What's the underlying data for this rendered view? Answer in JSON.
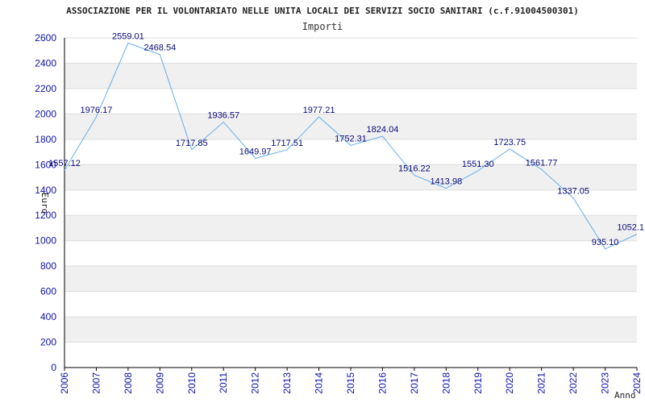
{
  "chart_data": {
    "type": "line",
    "title": "ASSOCIAZIONE PER IL VOLONTARIATO NELLE UNITA LOCALI DEI SERVIZI SOCIO SANITARI (c.f.91004500301)",
    "subtitle": "Importi",
    "xlabel": "Anno",
    "ylabel": "Euro",
    "ylim": [
      0,
      2600
    ],
    "yticks": [
      0,
      200,
      400,
      600,
      800,
      1000,
      1200,
      1400,
      1600,
      1800,
      2000,
      2200,
      2400,
      2600
    ],
    "x": [
      "2006",
      "2007",
      "2008",
      "2009",
      "2010",
      "2011",
      "2012",
      "2013",
      "2014",
      "2015",
      "2016",
      "2017",
      "2018",
      "2019",
      "2020",
      "2021",
      "2022",
      "2023",
      "2024"
    ],
    "values": [
      1557.12,
      1976.17,
      2559.01,
      2468.54,
      1717.85,
      1936.57,
      1649.97,
      1717.51,
      1977.21,
      1752.31,
      1824.04,
      1516.22,
      1413.98,
      1551.3,
      1723.75,
      1561.77,
      1337.05,
      935.1,
      1052.1
    ],
    "labels": [
      "1557.12",
      "1976.17",
      "2559.01",
      "2468.54",
      "1717.85",
      "1936.57",
      "1649.97",
      "1717.51",
      "1977.21",
      "1752.31",
      "1824.04",
      "1516.22",
      "1413.98",
      "1551.30",
      "1723.75",
      "1561.77",
      "1337.05",
      "935.10",
      "1052.1"
    ],
    "grid": true,
    "colors": {
      "line": "#6aaee6",
      "band": "#f0f0f0",
      "grid": "#dddddd",
      "axis": "#000000",
      "tick_text": "#1010aa",
      "data_text": "#0a0a7a"
    }
  }
}
